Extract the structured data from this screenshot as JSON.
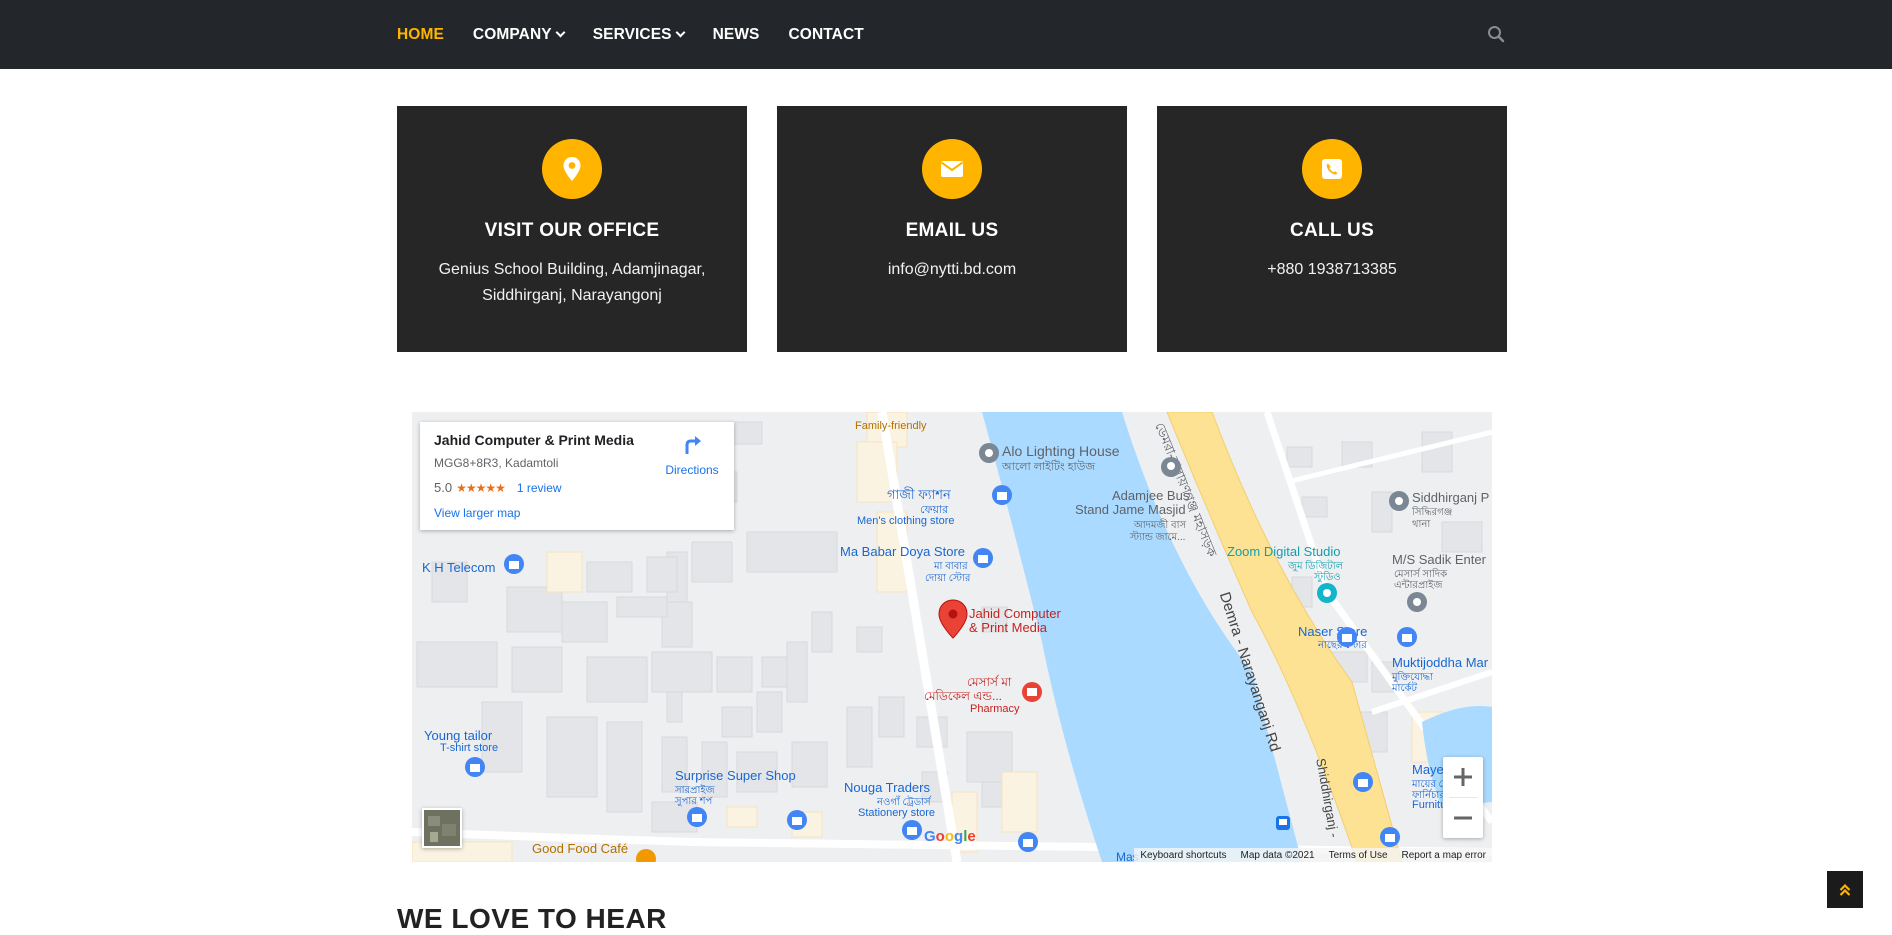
{
  "nav": {
    "items": [
      {
        "label": "HOME",
        "active": true,
        "dropdown": false
      },
      {
        "label": "COMPANY",
        "active": false,
        "dropdown": true
      },
      {
        "label": "SERVICES",
        "active": false,
        "dropdown": true
      },
      {
        "label": "NEWS",
        "active": false,
        "dropdown": false
      },
      {
        "label": "CONTACT",
        "active": false,
        "dropdown": false
      }
    ],
    "search_icon": "search-icon"
  },
  "cards": [
    {
      "icon": "map-pin-icon",
      "title": "VISIT OUR OFFICE",
      "line1": "Genius School Building, Adamjinagar,",
      "line2": "Siddhirganj, Narayangonj"
    },
    {
      "icon": "envelope-icon",
      "title": "EMAIL US",
      "line1": "info@nytti.bd.com",
      "line2": ""
    },
    {
      "icon": "phone-icon",
      "title": "CALL US",
      "line1": "+880 1938713385",
      "line2": ""
    }
  ],
  "map": {
    "place": {
      "name": "Jahid Computer & Print Media",
      "address": "MGG8+8R3, Kadamtoli",
      "rating": "5.0",
      "stars": "★★★★★",
      "reviews": "1 review",
      "larger_map": "View larger map",
      "directions": "Directions"
    },
    "labels": {
      "family_friendly": "Family-friendly",
      "alo_lighting": "Alo Lighting House",
      "alo_lighting_bn": "আলো লাইটিং হাউজ",
      "gazi_fashion_bn1": "গাজী ফ্যাশন",
      "gazi_fashion_bn2": "ফেয়ার",
      "mens_clothing": "Men's clothing store",
      "adamjee_bus1": "Adamjee Bus",
      "adamjee_bus2": "Stand Jame Masjid",
      "adamjee_bus_bn1": "আদমজী বাস",
      "adamjee_bus_bn2": "স্ট্যান্ড জামে...",
      "road_bn": "ডেমরা-নারায়ণগঞ্জ মহাসড়ক",
      "siddhirganj_p": "Siddhirganj P",
      "siddhirganj_p_bn1": "সিদ্ধিরগঞ্জ",
      "siddhirganj_p_bn2": "থানা",
      "ma_babar": "Ma Babar Doya Store",
      "ma_babar_bn1": "মা বাবার",
      "ma_babar_bn2": "দোয়া স্টোর",
      "zoom_digital": "Zoom Digital Studio",
      "zoom_digital_bn1": "জুম ডিজিটাল",
      "zoom_digital_bn2": "স্টুডিও",
      "ms_sadik": "M/S Sadik Enter",
      "ms_sadik_bn1": "মেসার্স সাদিক",
      "ms_sadik_bn2": "এন্টারপ্রাইজ",
      "kh_telecom": "K H Telecom",
      "jahid_pin1": "Jahid Computer",
      "jahid_pin2": "& Print Media",
      "demra_road": "Demra - Narayanganj Rd",
      "naser_store": "Naser Store",
      "naser_store_bn": "নাছের স্টোর",
      "muktijoddha": "Muktijoddha Mar",
      "muktijoddha_bn1": "মুক্তিযোদ্ধা",
      "muktijoddha_bn2": "মার্কেট",
      "pharmacy_bn1": "মেসার্স মা",
      "pharmacy_bn2": "মেডিকেল এন্ড...",
      "pharmacy": "Pharmacy",
      "young_tailor": "Young tailor",
      "tshirt_store": "T-shirt store",
      "surprise_shop": "Surprise Super Shop",
      "surprise_shop_bn1": "সারপ্রাইজ",
      "surprise_shop_bn2": "সুপার শপ",
      "nouga_traders": "Nouga Traders",
      "nouga_traders_bn": "নওগাঁ ট্রেডার্স",
      "stationery": "Stationery store",
      "shiddhirganj_road": "Shiddhirganj -",
      "mayer_dow": "Mayer Dow",
      "mayer_dow_bn1": "মায়ের দোয়া",
      "mayer_dow_bn2": "ফার্নিচার",
      "furniture_store": "Furniture stor",
      "good_food": "Good Food Café",
      "mas": "Mas"
    },
    "google": "Google",
    "footer": {
      "shortcuts": "Keyboard shortcuts",
      "map_data": "Map data ©2021",
      "terms": "Terms of Use",
      "report": "Report a map error"
    },
    "colors": {
      "water": "#aadaff",
      "road_major": "#fde293",
      "road_minor": "#ffffff",
      "building": "#e8e8e8",
      "land": "#eeeff1"
    }
  },
  "section_heading": "WE LOVE TO HEAR",
  "accent": "#ffb400"
}
